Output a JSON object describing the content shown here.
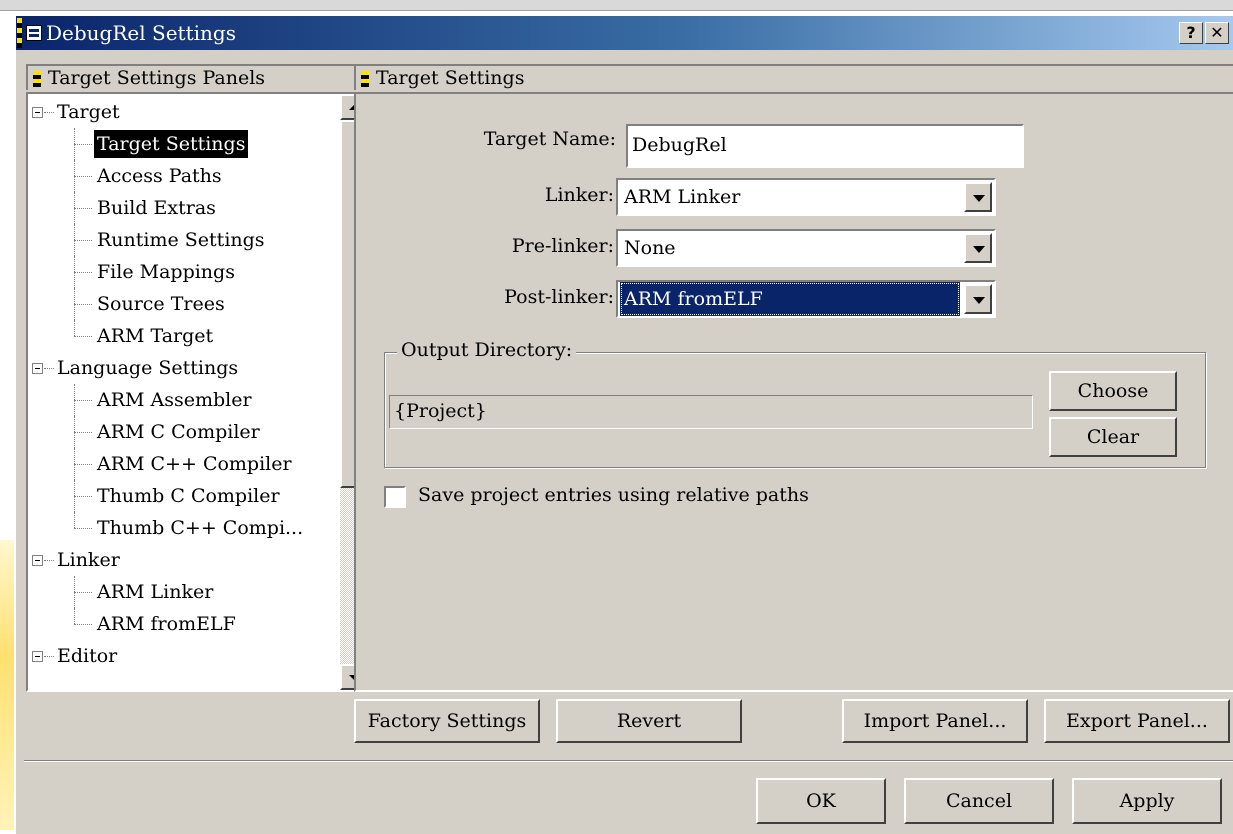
{
  "window": {
    "title": "DebugRel Settings",
    "help_label": "?",
    "close_label": "✕"
  },
  "left_panel": {
    "header": "Target Settings Panels",
    "tree": [
      {
        "label": "Target",
        "level": 0,
        "expanded": true
      },
      {
        "label": "Target Settings",
        "level": 1,
        "selected": true
      },
      {
        "label": "Access Paths",
        "level": 1
      },
      {
        "label": "Build Extras",
        "level": 1
      },
      {
        "label": "Runtime Settings",
        "level": 1
      },
      {
        "label": "File Mappings",
        "level": 1
      },
      {
        "label": "Source Trees",
        "level": 1
      },
      {
        "label": "ARM Target",
        "level": 1
      },
      {
        "label": "Language Settings",
        "level": 0,
        "expanded": true
      },
      {
        "label": "ARM Assembler",
        "level": 1
      },
      {
        "label": "ARM C Compiler",
        "level": 1
      },
      {
        "label": "ARM C++ Compiler",
        "level": 1
      },
      {
        "label": "Thumb C Compiler",
        "level": 1
      },
      {
        "label": "Thumb C++ Compi...",
        "level": 1
      },
      {
        "label": "Linker",
        "level": 0,
        "expanded": true
      },
      {
        "label": "ARM Linker",
        "level": 1
      },
      {
        "label": "ARM fromELF",
        "level": 1
      },
      {
        "label": "Editor",
        "level": 0,
        "expanded": true
      }
    ]
  },
  "right_panel": {
    "header": "Target Settings",
    "target_name_label": "Target Name:",
    "target_name_value": "DebugRel",
    "linker_label": "Linker:",
    "linker_value": "ARM Linker",
    "prelinker_label": "Pre-linker:",
    "prelinker_value": "None",
    "postlinker_label": "Post-linker:",
    "postlinker_value": "ARM fromELF",
    "output_dir_legend": "Output Directory:",
    "output_dir_value": "{Project}",
    "choose_label": "Choose",
    "clear_label": "Clear",
    "relative_paths_label": "Save project entries using relative paths",
    "relative_paths_checked": false
  },
  "panel_buttons": {
    "factory": "Factory Settings",
    "revert": "Revert",
    "import": "Import Panel...",
    "export": "Export Panel..."
  },
  "dialog_buttons": {
    "ok": "OK",
    "cancel": "Cancel",
    "apply": "Apply"
  },
  "colors": {
    "dialog_face": "#d4d0c8",
    "titlebar_start": "#0a246a",
    "titlebar_end": "#a6caf0",
    "selection": "#0a246a"
  }
}
